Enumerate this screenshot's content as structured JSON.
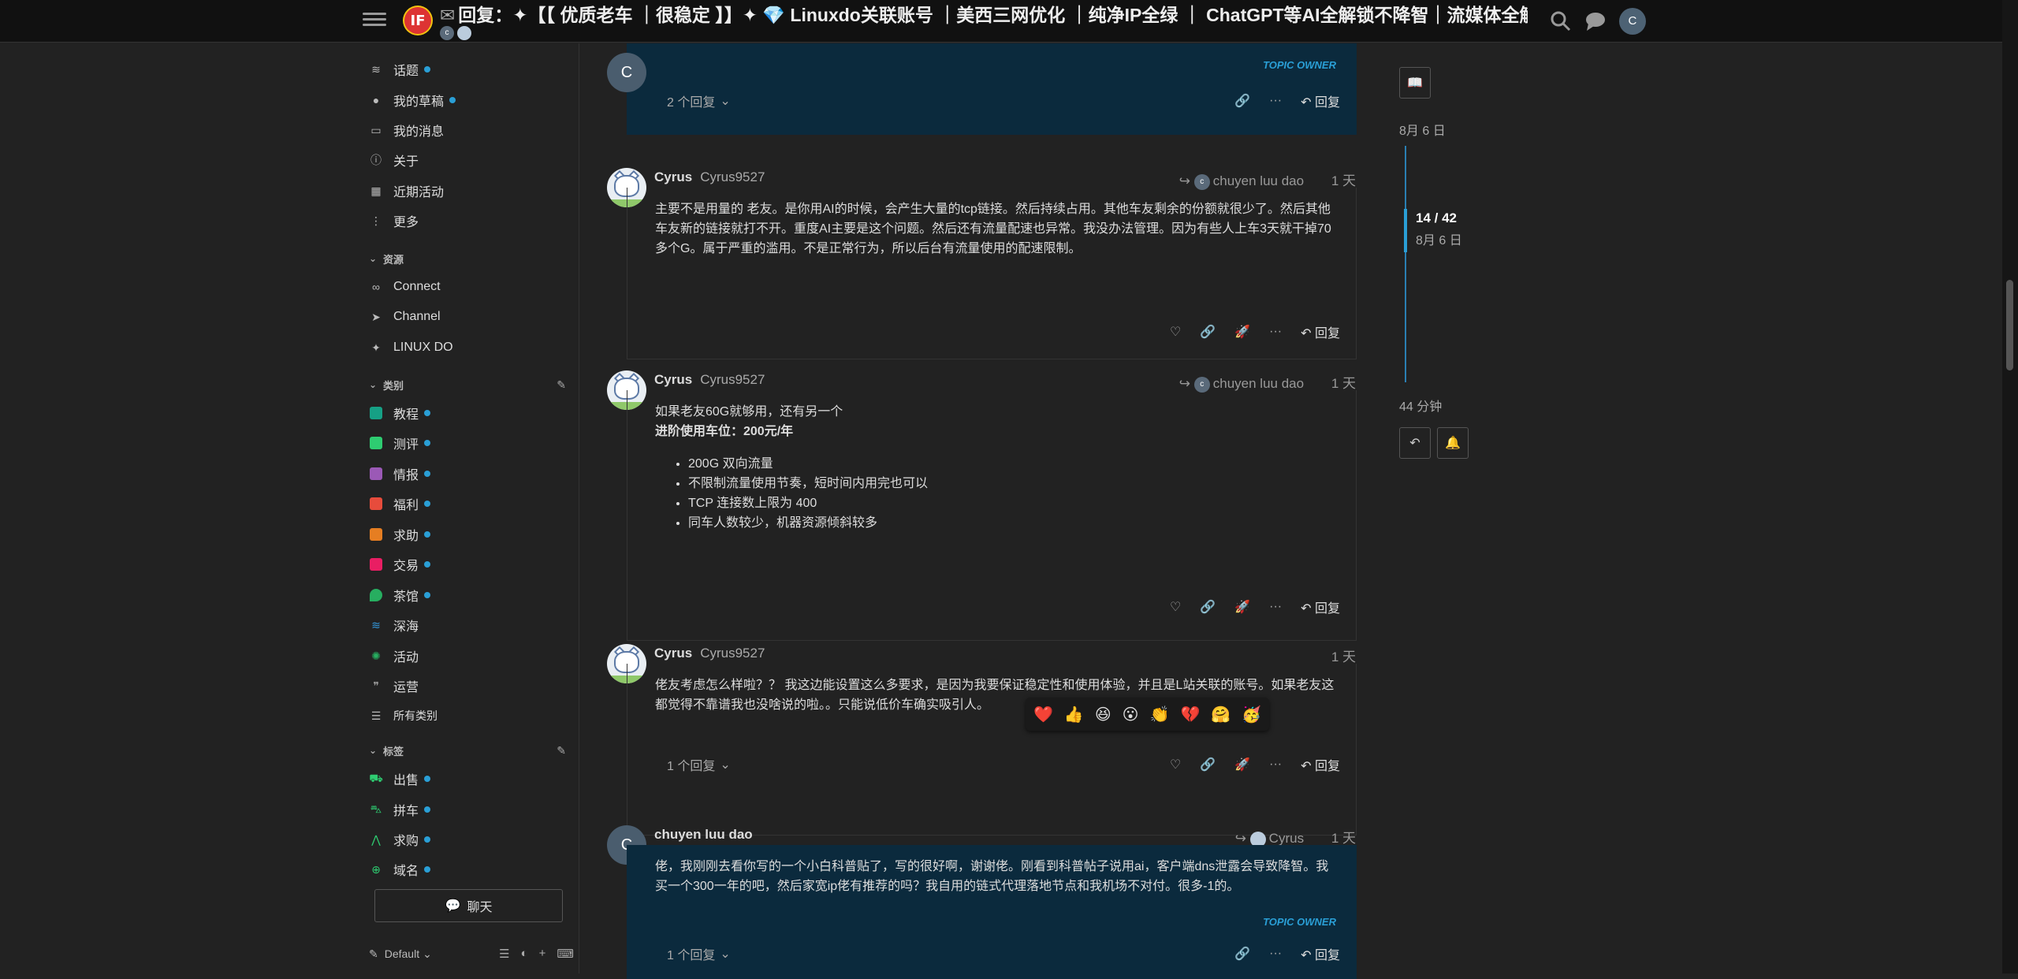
{
  "header": {
    "title": "回复：✦【【 优质老车 ｜很稳定 】】✦ 💎 Linuxdo关联账号 ｜美西三网优化 ｜纯净IP全绿 ｜ ChatGPT等AI全解锁不降智｜流媒体全解锁...",
    "avatar_letter": "c",
    "user_letter": "C",
    "logo_text": "IF"
  },
  "sidebar": {
    "nav": [
      {
        "label": "话题",
        "icon": "layers-icon",
        "dot": true
      },
      {
        "label": "我的草稿",
        "icon": "user-icon",
        "dot": true
      },
      {
        "label": "我的消息",
        "icon": "inbox-icon",
        "dot": false
      },
      {
        "label": "关于",
        "icon": "info-icon",
        "dot": false
      },
      {
        "label": "近期活动",
        "icon": "calendar-icon",
        "dot": false
      },
      {
        "label": "更多",
        "icon": "more-vertical-icon",
        "dot": false
      }
    ],
    "resources_title": "资源",
    "resources": [
      {
        "label": "Connect",
        "icon": "link-icon"
      },
      {
        "label": "Channel",
        "icon": "telegram-icon"
      },
      {
        "label": "LINUX DO",
        "icon": "sparkle-icon"
      }
    ],
    "categories_title": "类别",
    "categories": [
      {
        "label": "教程",
        "color": "#16a085",
        "dot": true
      },
      {
        "label": "测评",
        "color": "#2ecc71",
        "dot": true
      },
      {
        "label": "情报",
        "color": "#9b59b6",
        "dot": true
      },
      {
        "label": "福利",
        "color": "#e74c3c",
        "dot": true
      },
      {
        "label": "求助",
        "color": "#e67e22",
        "dot": true
      },
      {
        "label": "交易",
        "color": "#e91e63",
        "dot": true
      },
      {
        "label": "茶馆",
        "color": "#27ae60",
        "dot": true
      },
      {
        "label": "深海",
        "color": "#3498db",
        "dot": false
      },
      {
        "label": "活动",
        "color": "#27ae60",
        "dot": false
      },
      {
        "label": "运营",
        "color": "#999999",
        "dot": false
      },
      {
        "label": "所有类别",
        "color": "#bbbbbb",
        "dot": false
      }
    ],
    "tags_title": "标签",
    "tags": [
      {
        "label": "出售",
        "color": "#2ecc71",
        "dot": true
      },
      {
        "label": "拼车",
        "color": "#2ecc71",
        "dot": true
      },
      {
        "label": "求购",
        "color": "#2ecc71",
        "dot": true
      },
      {
        "label": "域名",
        "color": "#2ecc71",
        "dot": true
      }
    ],
    "chat_label": "聊天",
    "theme_label": "Default"
  },
  "posts": [
    {
      "avatar": "C",
      "owner": true,
      "topic_owner_label": "TOPIC OWNER",
      "replies_label": "2 个回复",
      "reply_label": "回复"
    },
    {
      "username": "Cyrus",
      "handle": "Cyrus9527",
      "reply_to": "chuyen luu dao",
      "reply_to_letter": "c",
      "time": "1 天",
      "text": "主要不是用量的 老友。是你用AI的时候，会产生大量的tcp链接。然后持续占用。其他车友剩余的份额就很少了。然后其他车友新的链接就打不开。重度AI主要是这个问题。然后还有流量配速也异常。我没办法管理。因为有些人上车3天就干掉70多个G。属于严重的滥用。不是正常行为，所以后台有流量使用的配速限制。",
      "reply_label": "回复"
    },
    {
      "username": "Cyrus",
      "handle": "Cyrus9527",
      "reply_to": "chuyen luu dao",
      "reply_to_letter": "c",
      "time": "1 天",
      "line1": "如果老友60G就够用，还有另一个",
      "line2": "进阶使用车位：200元/年",
      "bullets": [
        "200G 双向流量",
        "不限制流量使用节奏，短时间内用完也可以",
        "TCP 连接数上限为 400",
        "同车人数较少，机器资源倾斜较多"
      ],
      "reply_label": "回复"
    },
    {
      "username": "Cyrus",
      "handle": "Cyrus9527",
      "time": "1 天",
      "text": "佬友考虑怎么样啦？？ 我这边能设置这么多要求，是因为我要保证稳定性和使用体验，并且是L站关联的账号。如果老友这都觉得不靠谱我也没啥说的啦。。只能说低价车确实吸引人。",
      "reactions": [
        "❤️",
        "👍",
        "😆",
        "😮",
        "👏",
        "💔",
        "🤗",
        "🥳"
      ],
      "replies_label": "1 个回复",
      "reply_label": "回复"
    },
    {
      "username": "chuyen luu dao",
      "avatar": "C",
      "reply_to": "Cyrus",
      "time": "1 天",
      "owner": true,
      "text": "佬，我刚刚去看你写的一个小白科普贴了，写的很好啊，谢谢佬。刚看到科普帖子说用ai，客户端dns泄露会导致降智。我买一个300一年的吧，然后家宽ip佬有推荐的吗？我自用的链式代理落地节点和我机场不对付。很多-1的。",
      "topic_owner_label": "TOPIC OWNER",
      "replies_label": "1 个回复",
      "reply_label": "回复"
    }
  ],
  "timeline": {
    "start_date": "8月 6 日",
    "position": "14 / 42",
    "position_date": "8月 6 日",
    "end": "44 分钟"
  },
  "colors": {
    "accent": "#2a9fd6",
    "owner_bg": "#0b2a3d",
    "background": "#222222",
    "header_bg": "#111111"
  }
}
